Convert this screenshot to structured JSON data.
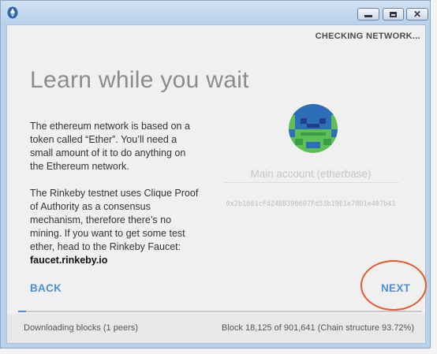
{
  "window": {
    "controls": {
      "minimize": "minimize",
      "maximize": "maximize",
      "close": "close"
    }
  },
  "status": {
    "text": "CHECKING NETWORK..."
  },
  "main": {
    "heading": "Learn while you wait",
    "paragraph1": "The ethereum network is based on a token called “Ether”. You’ll need a small amount of it to do anything on the Ethereum network.",
    "paragraph2": "The Rinkeby testnet uses Clique Proof of Authority as a consensus mechanism, therefore there’s no mining. If you want to get some test ether, head to the Rinkeby Faucet:",
    "faucet_link": "faucet.rinkeby.io"
  },
  "account": {
    "name": "Main account (etherbase)",
    "address": "0x2b1681cFd24BB398607Fd53b19E1e78D1e407b41",
    "avatar_colors": {
      "green": "#5fbf57",
      "blue": "#2c6fb8",
      "dark": "#1e3f8a"
    }
  },
  "navigation": {
    "back_label": "BACK",
    "next_label": "NEXT"
  },
  "progress": {
    "fraction": 0.0201
  },
  "footer": {
    "download_status": "Downloading blocks (1 peers)",
    "block_status": "Block 18,125 of 901,641 (Chain structure 93.72%)"
  },
  "colors": {
    "accent": "#4b8fd8",
    "highlight_ring": "#e45a2c"
  }
}
